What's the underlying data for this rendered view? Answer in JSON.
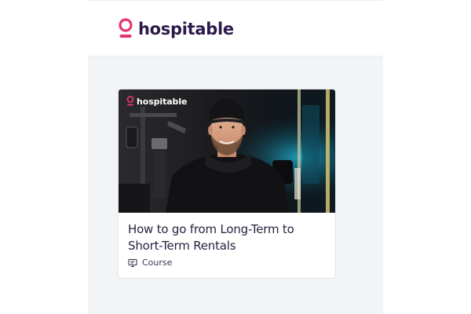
{
  "header": {
    "brand_name": "hospitable",
    "brand_color": "#e8336e",
    "logo_icon": "location-pin-icon"
  },
  "course_card": {
    "thumbnail": {
      "overlay_brand": "hospitable",
      "description_icon": "video-thumbnail"
    },
    "title": "How to go from Long-Term to Short-Term Rentals",
    "type_label": "Course",
    "type_icon": "presentation-icon"
  }
}
